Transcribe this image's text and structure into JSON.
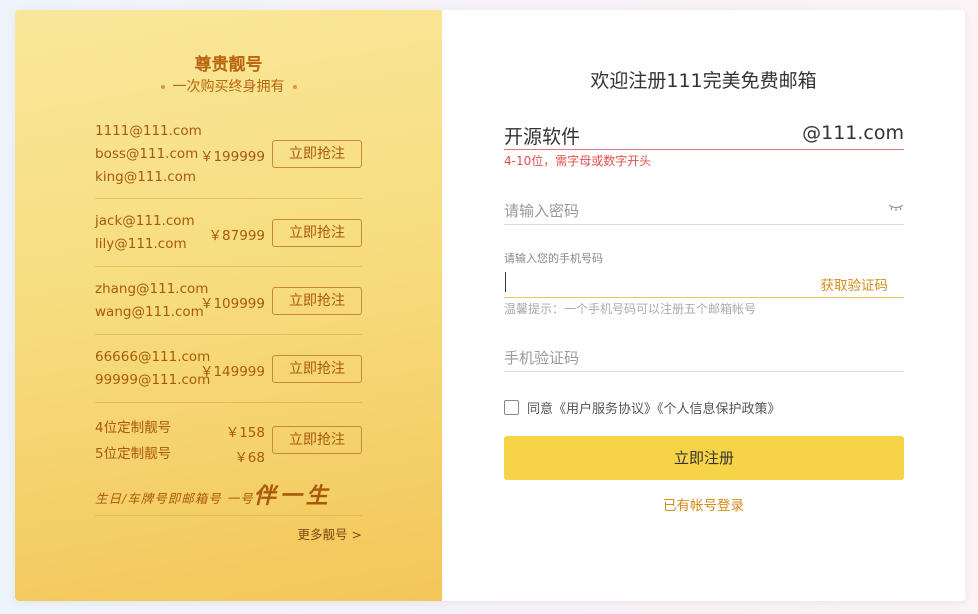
{
  "promo": {
    "title": "尊贵靓号",
    "subtitle": "一次购买终身拥有",
    "groups": [
      {
        "emails": [
          "1111@111.com",
          "boss@111.com",
          "king@111.com"
        ],
        "price": "￥199999",
        "button": "立即抢注"
      },
      {
        "emails": [
          "jack@111.com",
          "lily@111.com"
        ],
        "price": "￥87999",
        "button": "立即抢注"
      },
      {
        "emails": [
          "zhang@111.com",
          "wang@111.com"
        ],
        "price": "￥109999",
        "button": "立即抢注"
      },
      {
        "emails": [
          "66666@111.com",
          "99999@111.com"
        ],
        "price": "￥149999",
        "button": "立即抢注"
      },
      {
        "emails": [
          "4位定制靓号",
          "5位定制靓号"
        ],
        "prices": [
          "￥158",
          "￥68"
        ],
        "button": "立即抢注"
      }
    ],
    "slogan_small": "生日/车牌号即邮箱号 一号",
    "slogan_big": "伴一生",
    "more": "更多靓号 >"
  },
  "register": {
    "title": "欢迎注册111完美免费邮箱",
    "username_value": "开源软件",
    "domain": "@111.com",
    "username_error": "4-10位，需字母或数字开头",
    "password_placeholder": "请输入密码",
    "phone_label": "请输入您的手机号码",
    "get_code": "获取验证码",
    "phone_tip": "温馨提示：一个手机号码可以注册五个邮箱帐号",
    "code_placeholder": "手机验证码",
    "agree_text": "同意《用户服务协议》《个人信息保护政策》",
    "submit": "立即注册",
    "login_link": "已有帐号登录"
  },
  "colors": {
    "accent": "#f7d447",
    "brand_text": "#a9590c",
    "error": "#e0504d",
    "link": "#d68a1c"
  }
}
